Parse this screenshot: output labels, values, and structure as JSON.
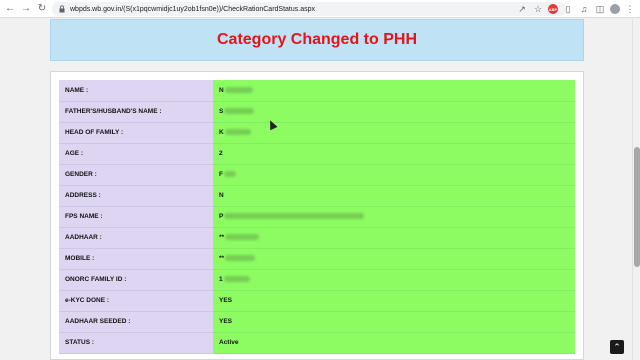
{
  "browser": {
    "url": "wbpds.wb.gov.in/(S(x1pqcwmidjc1uy2ob1fsn0e))/CheckRationCardStatus.aspx",
    "icons": [
      "back-icon",
      "forward-icon",
      "reload-icon",
      "lock-icon",
      "share-icon",
      "star-icon",
      "extension-badge-icon",
      "puzzle-icon",
      "media-icon",
      "sidepanel-icon",
      "profile-icon",
      "menu-icon"
    ]
  },
  "page": {
    "title": "Category Changed to PHH",
    "title_color": "#e3141c",
    "header_bg": "#bfe3f5",
    "label_bg": "#ded5f2",
    "value_bg": "#8dfb62"
  },
  "rows": [
    {
      "label": "NAME :",
      "value": "N"
    },
    {
      "label": "FATHER'S/HUSBAND'S NAME :",
      "value": "S"
    },
    {
      "label": "HEAD OF FAMILY :",
      "value": "K"
    },
    {
      "label": "AGE :",
      "value": "2"
    },
    {
      "label": "GENDER :",
      "value": "F"
    },
    {
      "label": "ADDRESS :",
      "value": "N"
    },
    {
      "label": "FPS NAME :",
      "value": "P"
    },
    {
      "label": "AADHAAR :",
      "value": "**"
    },
    {
      "label": "MOBILE :",
      "value": "**"
    },
    {
      "label": "ONORC FAMILY ID :",
      "value": "1"
    },
    {
      "label": "e-KYC DONE :",
      "value": "YES"
    },
    {
      "label": "AADHAAR SEEDED :",
      "value": "YES"
    },
    {
      "label": "STATUS :",
      "value": "Active"
    }
  ]
}
